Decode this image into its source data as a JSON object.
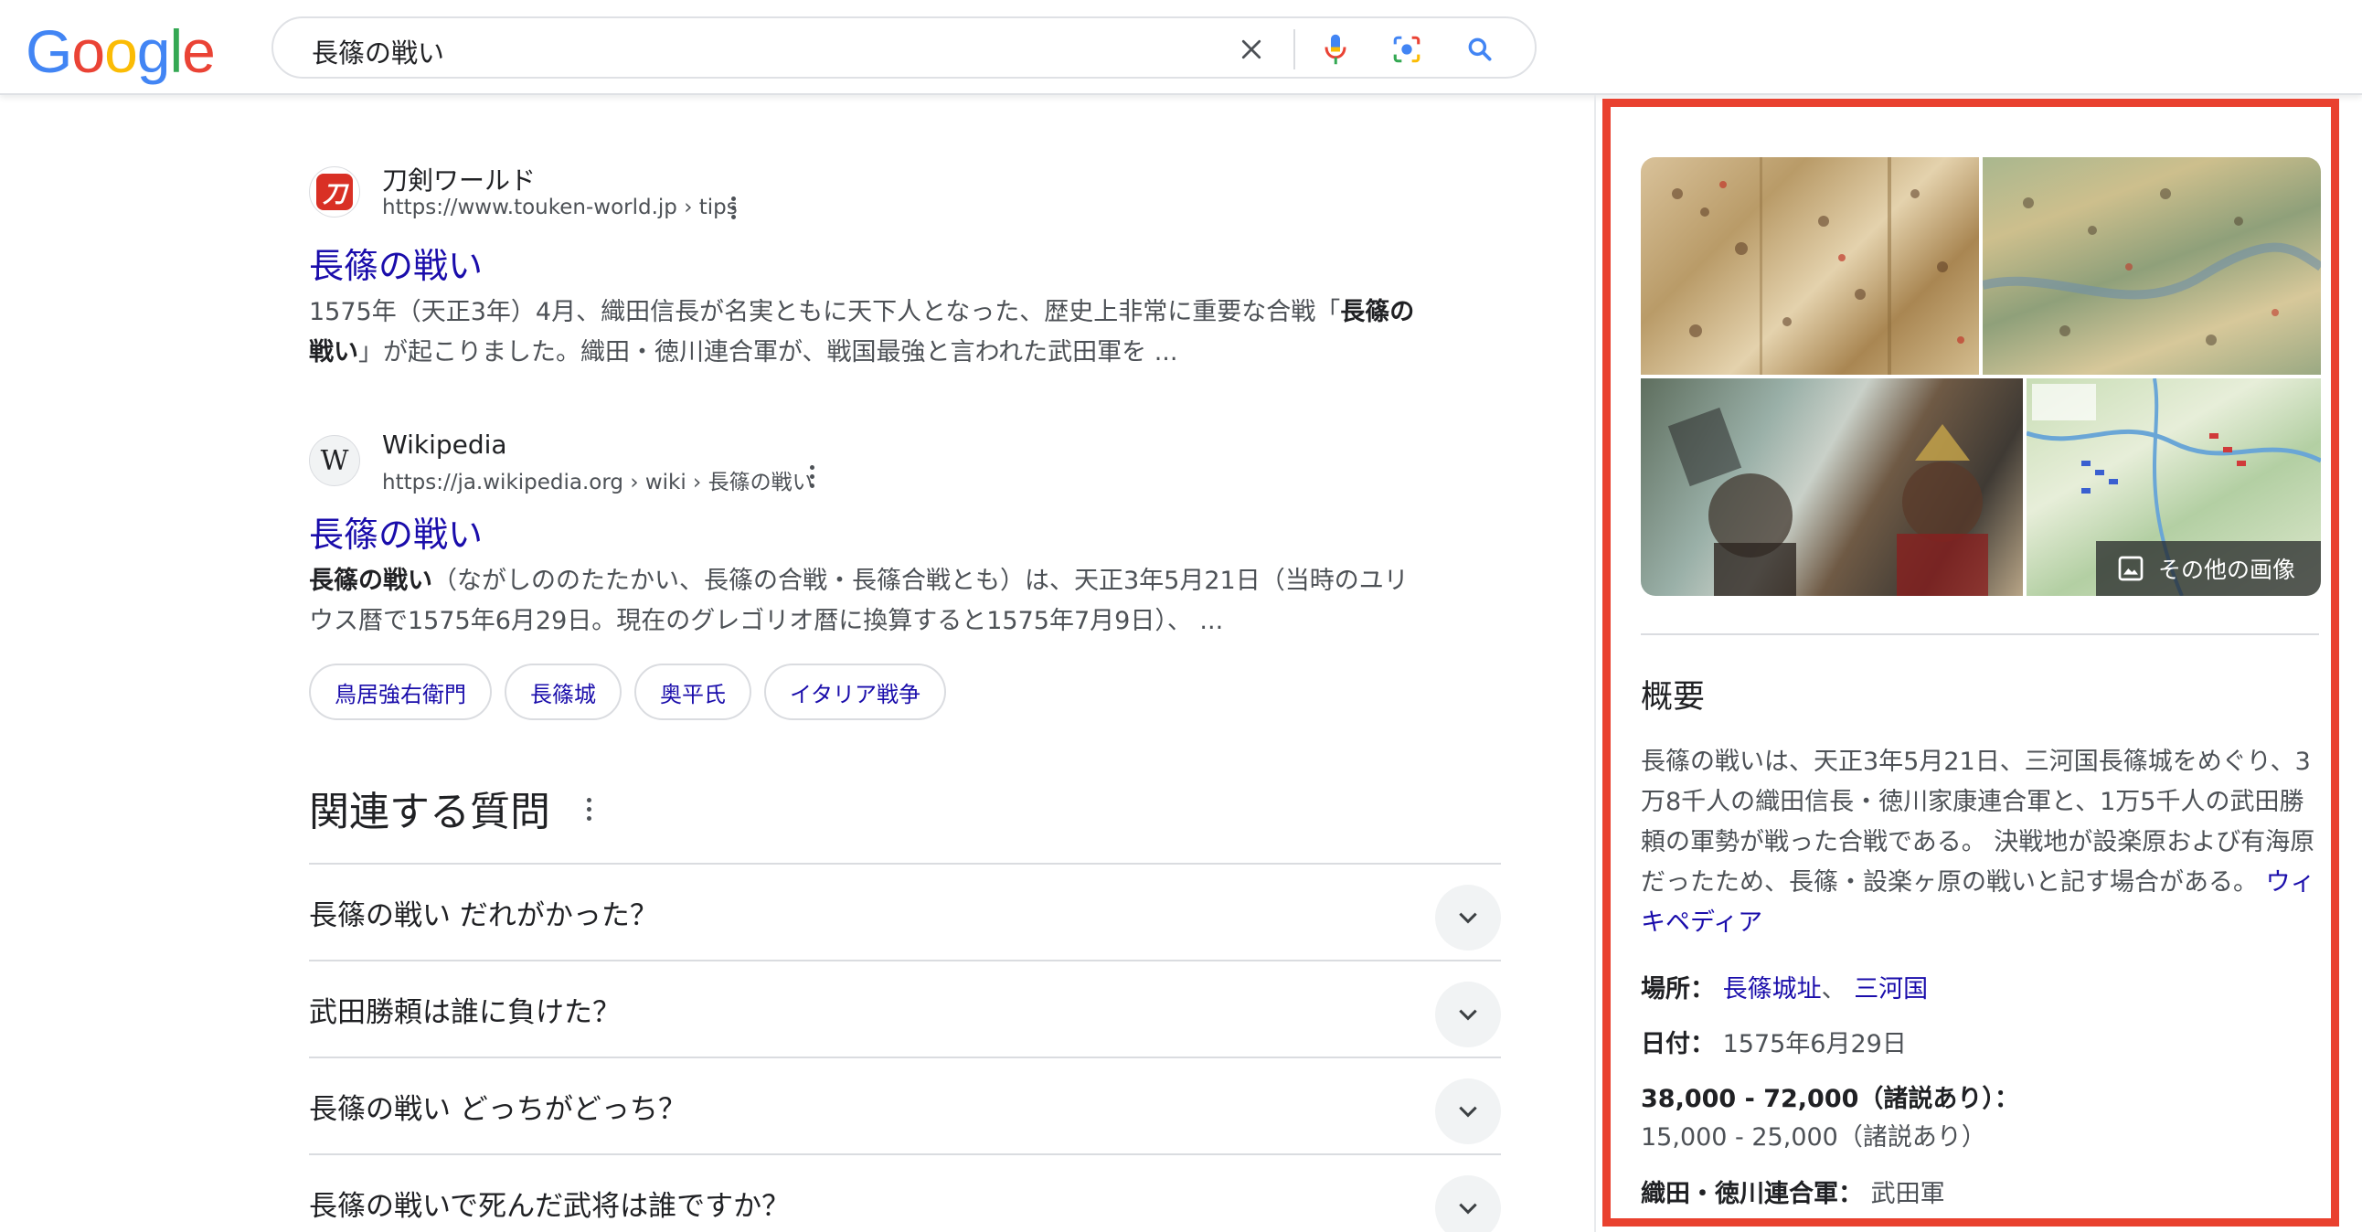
{
  "header": {
    "logo_letters": [
      "G",
      "o",
      "o",
      "g",
      "l",
      "e"
    ],
    "logo_colors": [
      "#4285F4",
      "#EA4335",
      "#FBBC05",
      "#4285F4",
      "#34A853",
      "#EA4335"
    ],
    "search_query": "長篠の戦い",
    "icons": [
      "clear-icon",
      "microphone-icon",
      "lens-icon",
      "search-icon"
    ]
  },
  "results": [
    {
      "site_name": "刀剣ワールド",
      "favicon_text": "刀",
      "url": "https://www.touken-world.jp › tips",
      "title": "長篠の戦い",
      "snippet_pre": "1575年（天正3年）4月、織田信長が名実ともに天下人となった、歴史上非常に重要な合戦「",
      "snippet_bold": "長篠の戦い",
      "snippet_post": "」が起こりました。織田・徳川連合軍が、戦国最強と言われた武田軍を ..."
    },
    {
      "site_name": "Wikipedia",
      "favicon_text": "W",
      "url": "https://ja.wikipedia.org › wiki › 長篠の戦い",
      "title": "長篠の戦い",
      "snippet_bold": "長篠の戦い",
      "snippet_post": "（ながしののたたかい、長篠の合戦・長篠合戦とも）は、天正3年5月21日（当時のユリウス暦で1575年6月29日。現在のグレゴリオ暦に換算すると1575年7月9日）、 ...",
      "chips": [
        "鳥居強右衛門",
        "長篠城",
        "奥平氏",
        "イタリア戦争"
      ]
    }
  ],
  "related": {
    "title": "関連する質問",
    "questions": [
      "長篠の戦い だれがかった？",
      "武田勝頼は誰に負けた？",
      "長篠の戦い どっちがどっち？",
      "長篠の戦いで死んだ武将は誰ですか？"
    ]
  },
  "knowledge_panel": {
    "more_images": "その他の画像",
    "heading": "概要",
    "description": "長篠の戦いは、天正3年5月21日、三河国長篠城をめぐり、3万8千人の織田信長・徳川家康連合軍と、1万5千人の武田勝頼の軍勢が戦った合戦である。 決戦地が設楽原および有海原だったため、長篠・設楽ヶ原の戦いと記す場合がある。",
    "source": "ウィキペディア",
    "facts": {
      "place_label": "場所：",
      "place_links": [
        "長篠城址",
        "三河国"
      ],
      "place_sep": "、",
      "date_label": "日付：",
      "date_value": "1575年6月29日",
      "strength_label": "38,000 - 72,000（諸説あり）：",
      "strength_value": "15,000 - 25,000（諸説あり）",
      "combatant_label": "織田・徳川連合軍：",
      "combatant_value": "武田軍"
    }
  }
}
